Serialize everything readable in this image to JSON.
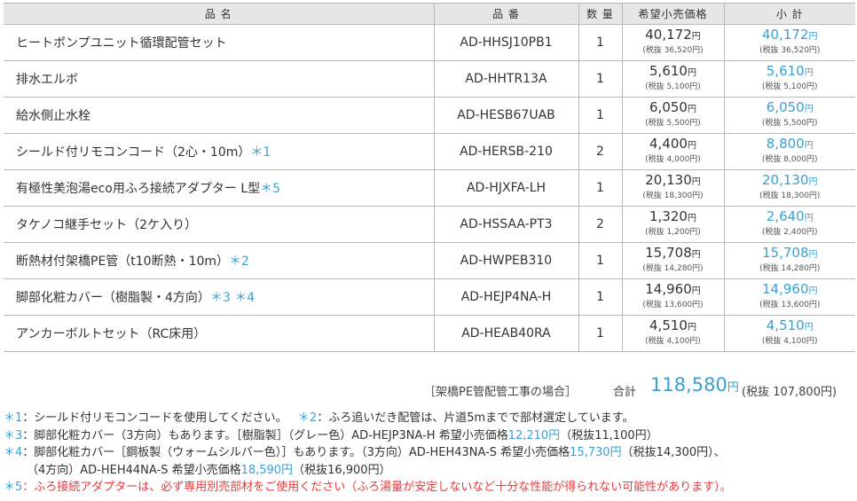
{
  "headers": {
    "name": "品 名",
    "code": "品 番",
    "qty": "数 量",
    "price": "希望小売価格",
    "subtotal": "小 計"
  },
  "yen": "円",
  "items": [
    {
      "name": "ヒートポンプユニット循環配管セット",
      "mark": "",
      "code": "AD-HHSJ10PB1",
      "qty": "1",
      "price": "40,172",
      "price_excl": "(税抜 36,520円)",
      "subtotal": "40,172",
      "subtotal_excl": "(税抜 36,520円)"
    },
    {
      "name": "排水エルボ",
      "mark": "",
      "code": "AD-HHTR13A",
      "qty": "1",
      "price": "5,610",
      "price_excl": "(税抜 5,100円)",
      "subtotal": "5,610",
      "subtotal_excl": "(税抜 5,100円)"
    },
    {
      "name": "給水側止水栓",
      "mark": "",
      "code": "AD-HESB67UAB",
      "qty": "1",
      "price": "6,050",
      "price_excl": "(税抜 5,500円)",
      "subtotal": "6,050",
      "subtotal_excl": "(税抜 5,500円)"
    },
    {
      "name": "シールド付リモコンコード（2心・10m）",
      "mark": "＊1",
      "code": "AD-HERSB-210",
      "qty": "2",
      "price": "4,400",
      "price_excl": "(税抜 4,000円)",
      "subtotal": "8,800",
      "subtotal_excl": "(税抜 8,000円)"
    },
    {
      "name": "有極性美泡湯eco用ふろ接続アダプター L型",
      "mark": "＊5",
      "code": "AD-HJXFA-LH",
      "qty": "1",
      "price": "20,130",
      "price_excl": "(税抜 18,300円)",
      "subtotal": "20,130",
      "subtotal_excl": "(税抜 18,300円)"
    },
    {
      "name": "タケノコ継手セット（2ケ入り）",
      "mark": "",
      "code": "AD-HSSAA-PT3",
      "qty": "2",
      "price": "1,320",
      "price_excl": "(税抜 1,200円)",
      "subtotal": "2,640",
      "subtotal_excl": "(税抜 2,400円)"
    },
    {
      "name": "断熱材付架橋PE管（t10断熱・10m）",
      "mark": "＊2",
      "code": "AD-HWPEB310",
      "qty": "1",
      "price": "15,708",
      "price_excl": "(税抜 14,280円)",
      "subtotal": "15,708",
      "subtotal_excl": "(税抜 14,280円)"
    },
    {
      "name": "脚部化粧カバー（樹脂製・4方向）",
      "mark": "＊3 ＊4",
      "code": "AD-HEJP4NA-H",
      "qty": "1",
      "price": "14,960",
      "price_excl": "(税抜 13,600円)",
      "subtotal": "14,960",
      "subtotal_excl": "(税抜 13,600円)"
    },
    {
      "name": "アンカーボルトセット（RC床用）",
      "mark": "",
      "code": "AD-HEAB40RA",
      "qty": "1",
      "price": "4,510",
      "price_excl": "(税抜 4,100円)",
      "subtotal": "4,510",
      "subtotal_excl": "(税抜 4,100円)"
    }
  ],
  "total": {
    "note": "［架橋PE管配管工事の場合］",
    "label": "合計",
    "value": "118,580",
    "yen": "円",
    "excl": "(税抜 107,800円)"
  },
  "notes": {
    "n1_mark": "＊1",
    "n1_text": "：シールド付リモコンコードを使用してください。",
    "n2_mark": "＊2",
    "n2_text": "：ふろ追いだき配管は、片道5mまでで部材選定しています。",
    "n3_mark": "＊3",
    "n3_text": "：脚部化粧カバー（3方向）もあります。［樹脂製］（グレー色）AD-HEJP3NA-H 希望小売価格",
    "n3_price": "12,210円",
    "n3_tail": "（税抜11,100円）",
    "n4_mark": "＊4",
    "n4_text": "：脚部化粧カバー［鋼板製（ウォームシルバー色）］もあります。（3方向）AD-HEH43NA-S 希望小売価格",
    "n4_price": "15,730円",
    "n4_tail": "（税抜14,300円）、",
    "n4b_text": "（4方向）AD-HEH44NA-S 希望小売価格",
    "n4b_price": "18,590円",
    "n4b_tail": "（税抜16,900円）",
    "n5_mark": "＊5",
    "n5_text": "：ふろ接続アダプターは、必ず専用別売部材をご使用ください（ふろ湯量が安定しないなど十分な性能が得られない可能性があります）。"
  },
  "colors": {
    "accent_blue": "#3aa0d6",
    "warning_red": "#e8393c",
    "header_gray": "#e6e6e6"
  }
}
